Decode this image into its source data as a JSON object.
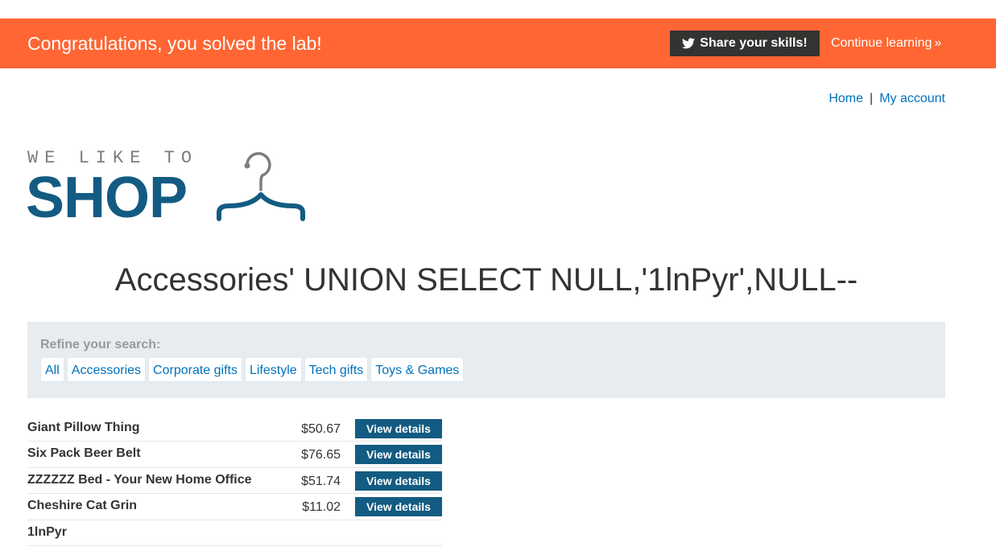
{
  "banner": {
    "message": "Congratulations, you solved the lab!",
    "share_label": "Share your skills!",
    "continue_label": "Continue learning",
    "color": "#ff6633"
  },
  "nav": {
    "home": "Home",
    "separator": "|",
    "account": "My account"
  },
  "logo": {
    "small_text": "WE LIKE TO",
    "big_text": "SHOP",
    "icon": "hanger-icon"
  },
  "page": {
    "title": "Accessories' UNION SELECT NULL,'1lnPyr',NULL--"
  },
  "refine": {
    "label": "Refine your search:",
    "filters": [
      "All",
      "Accessories",
      "Corporate gifts",
      "Lifestyle",
      "Tech gifts",
      "Toys & Games"
    ]
  },
  "products": [
    {
      "name": "Giant Pillow Thing",
      "price": "$50.67",
      "button": "View details"
    },
    {
      "name": "Six Pack Beer Belt",
      "price": "$76.65",
      "button": "View details"
    },
    {
      "name": "ZZZZZZ Bed - Your New Home Office",
      "price": "$51.74",
      "button": "View details"
    },
    {
      "name": "Cheshire Cat Grin",
      "price": "$11.02",
      "button": "View details"
    },
    {
      "name": "1lnPyr",
      "price": "",
      "button": ""
    }
  ],
  "colors": {
    "brand": "#135b82",
    "link": "#0071bc",
    "refine_bg": "#e7ecf0"
  }
}
